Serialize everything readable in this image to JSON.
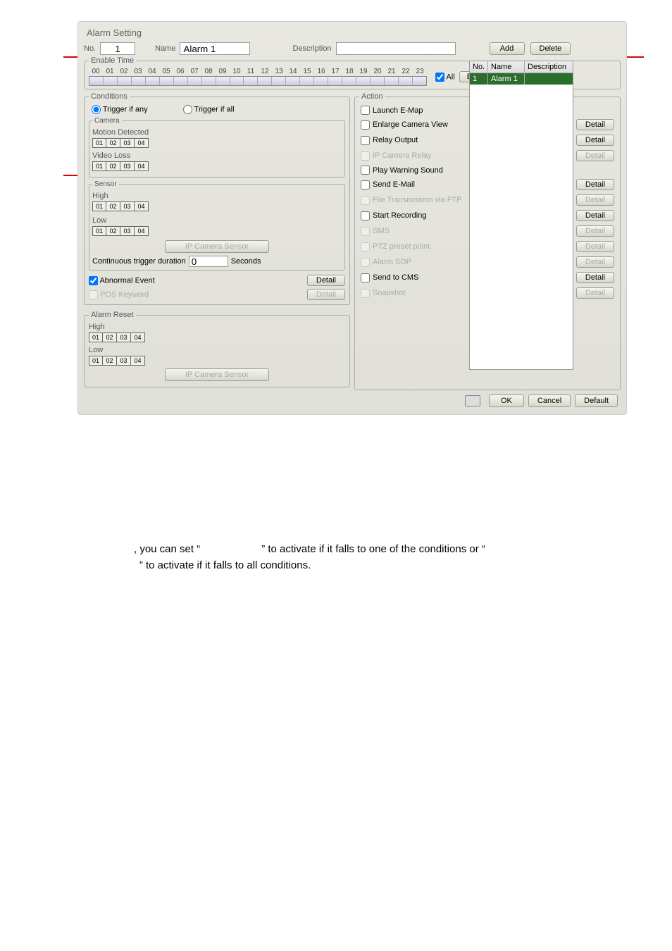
{
  "dialog": {
    "title": "Alarm Setting"
  },
  "top": {
    "noLabel": "No.",
    "noValue": "1",
    "nameLabel": "Name",
    "nameValue": "Alarm 1",
    "descLabel": "Description",
    "descValue": "",
    "addLabel": "Add",
    "deleteLabel": "Delete"
  },
  "enableTime": {
    "legend": "Enable Time",
    "hours": [
      "00",
      "01",
      "02",
      "03",
      "04",
      "05",
      "06",
      "07",
      "08",
      "09",
      "10",
      "11",
      "12",
      "13",
      "14",
      "15",
      "16",
      "17",
      "18",
      "19",
      "20",
      "21",
      "22",
      "23"
    ],
    "allLabel": "All",
    "enableLabel": "Enable"
  },
  "table": {
    "headNo": "No.",
    "headName": "Name",
    "headDesc": "Description",
    "row1No": "1",
    "row1Name": "Alarm 1",
    "row1Desc": ""
  },
  "conditions": {
    "legend": "Conditions",
    "triggerAny": "Trigger if any",
    "triggerAll": "Trigger if all",
    "cameraLegend": "Camera",
    "motionDetected": "Motion Detected",
    "videoLoss": "Video Loss",
    "channels": [
      "01",
      "02",
      "03",
      "04"
    ],
    "sensorLegend": "Sensor",
    "high": "High",
    "low": "Low",
    "ipCameraSensor": "IP Camera Sensor",
    "contTriggerLabel": "Continuous trigger duration",
    "contTriggerValue": "0",
    "secondsLabel": "Seconds",
    "abnormalEvent": "Abnormal Event",
    "posKeyword": "POS Keyword",
    "detailLabel": "Detail"
  },
  "action": {
    "legend": "Action",
    "launchEmap": "Launch E-Map",
    "enlargeCamera": "Enlarge Camera View",
    "relayOutput": "Relay Output",
    "ipCameraRelay": "IP Camera Relay",
    "playWarning": "Play Warning Sound",
    "sendEmail": "Send E-Mail",
    "fileFtp": "File Transmission via FTP",
    "startRecording": "Start Recording",
    "sms": "SMS",
    "ptzPreset": "PTZ preset point",
    "alarmSop": "Alarm SOP",
    "sendCms": "Send to CMS",
    "snapshot": "Snapshot",
    "detailLabel": "Detail"
  },
  "alarmReset": {
    "legend": "Alarm Reset",
    "high": "High",
    "low": "Low",
    "ipCameraSensor": "IP Camera Sensor",
    "channels": [
      "01",
      "02",
      "03",
      "04"
    ]
  },
  "bottom": {
    "ok": "OK",
    "cancel": "Cancel",
    "default": "Default"
  },
  "footer": {
    "line1a": ", you can set “",
    "line1b": "” to activate if it falls to one of the conditions or “",
    "line2": "” to activate if it falls to all conditions."
  }
}
